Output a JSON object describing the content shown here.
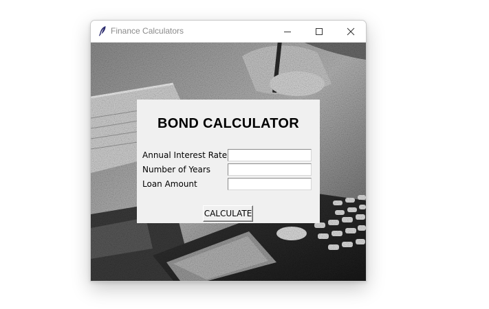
{
  "window": {
    "title": "Finance Calculators",
    "app_icon": "feather-icon",
    "controls": {
      "minimize": "minimize-icon",
      "maximize": "maximize-icon",
      "close": "close-icon"
    }
  },
  "form": {
    "heading": "BOND CALCULATOR",
    "fields": [
      {
        "label": "Annual Interest Rate",
        "value": ""
      },
      {
        "label": "Number of Years",
        "value": ""
      },
      {
        "label": "Loan Amount",
        "value": ""
      }
    ],
    "submit_label": "CALCULATE"
  },
  "background": {
    "description_icon": "calculator-photo"
  },
  "colors": {
    "window_bg": "#f0f0f0",
    "titlebar_bg": "#ffffff",
    "title_text": "#8a8a8a"
  }
}
